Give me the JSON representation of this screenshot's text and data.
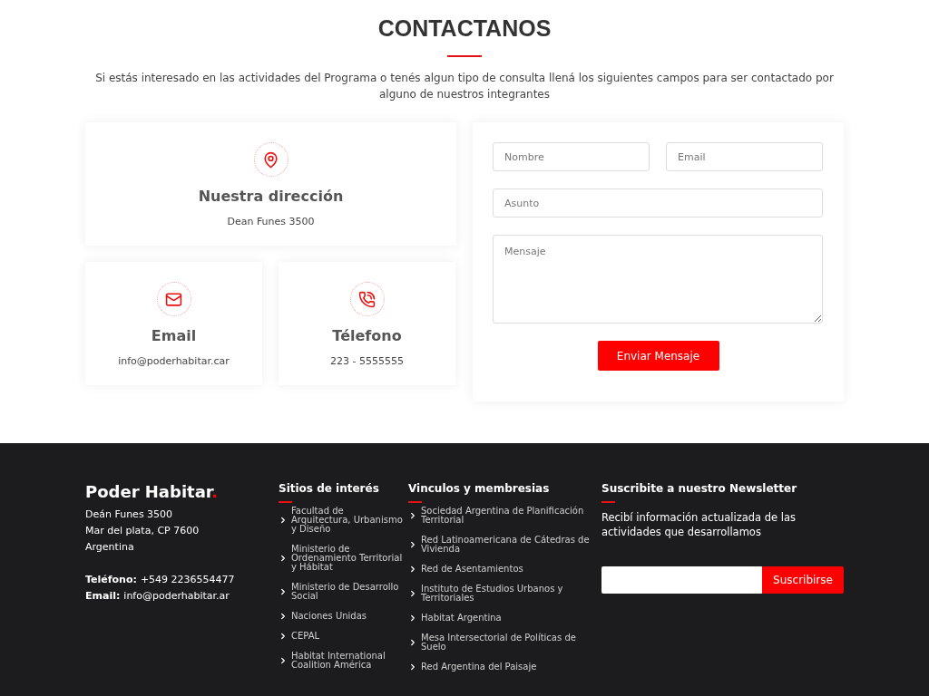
{
  "contact": {
    "title": "CONTACTANOS",
    "intro": "Si estás interesado en las actividades del Programa o tenés algun tipo de consulta llená los siguientes campos para ser contactado por alguno de nuestros integrantes",
    "cards": [
      {
        "kind": "address",
        "title": "Nuestra dirección",
        "value": "Dean Funes 3500"
      },
      {
        "kind": "email",
        "title": "Email",
        "value": "info@poderhabitar.car"
      },
      {
        "kind": "phone",
        "title": "Télefono",
        "value": "223 - 5555555"
      }
    ],
    "form": {
      "name": {
        "placeholder": "Nombre"
      },
      "email": {
        "placeholder": "Email"
      },
      "subject": {
        "placeholder": "Asunto"
      },
      "message": {
        "placeholder": "Mensaje"
      },
      "submit": "Enviar Mensaje"
    }
  },
  "footer": {
    "brand": "Poder Habitar",
    "brand_dot": ".",
    "address_lines": [
      "Deán Funes 3500",
      "Mar del plata, CP 7600",
      "Argentina"
    ],
    "contacts": [
      {
        "label": "Teléfono:",
        "value": "+549 2236554477"
      },
      {
        "label": "Email:",
        "value": "info@poderhabitar.ar"
      }
    ],
    "link_columns": [
      {
        "title": "Sitios de interés",
        "links": [
          "Facultad de Arquitectura, Urbanismo y Diseño",
          "Ministerio de Ordenamiento Territorial y Hábitat",
          "Ministerio de Desarrollo Social",
          "Naciones Unidas",
          "CEPAL",
          "Habitat International Coalition América"
        ]
      },
      {
        "title": "Vinculos y membresias",
        "links": [
          "Sociedad Argentina de Planificación Territorial",
          "Red Latinoamericana de Cátedras de Vivienda",
          "Red de Asentamientos",
          "Instituto de Estudios Urbanos y Territoriales",
          "Habitat Argentina",
          "Mesa Intersectorial de Políticas de Suelo",
          "Red Argentina del Paisaje"
        ]
      }
    ],
    "newsletter": {
      "title": "Suscribite a nuestro Newsletter",
      "text": "Recibí información actualizada de las actividades que desarrollamos",
      "button": "Suscribirse"
    }
  }
}
